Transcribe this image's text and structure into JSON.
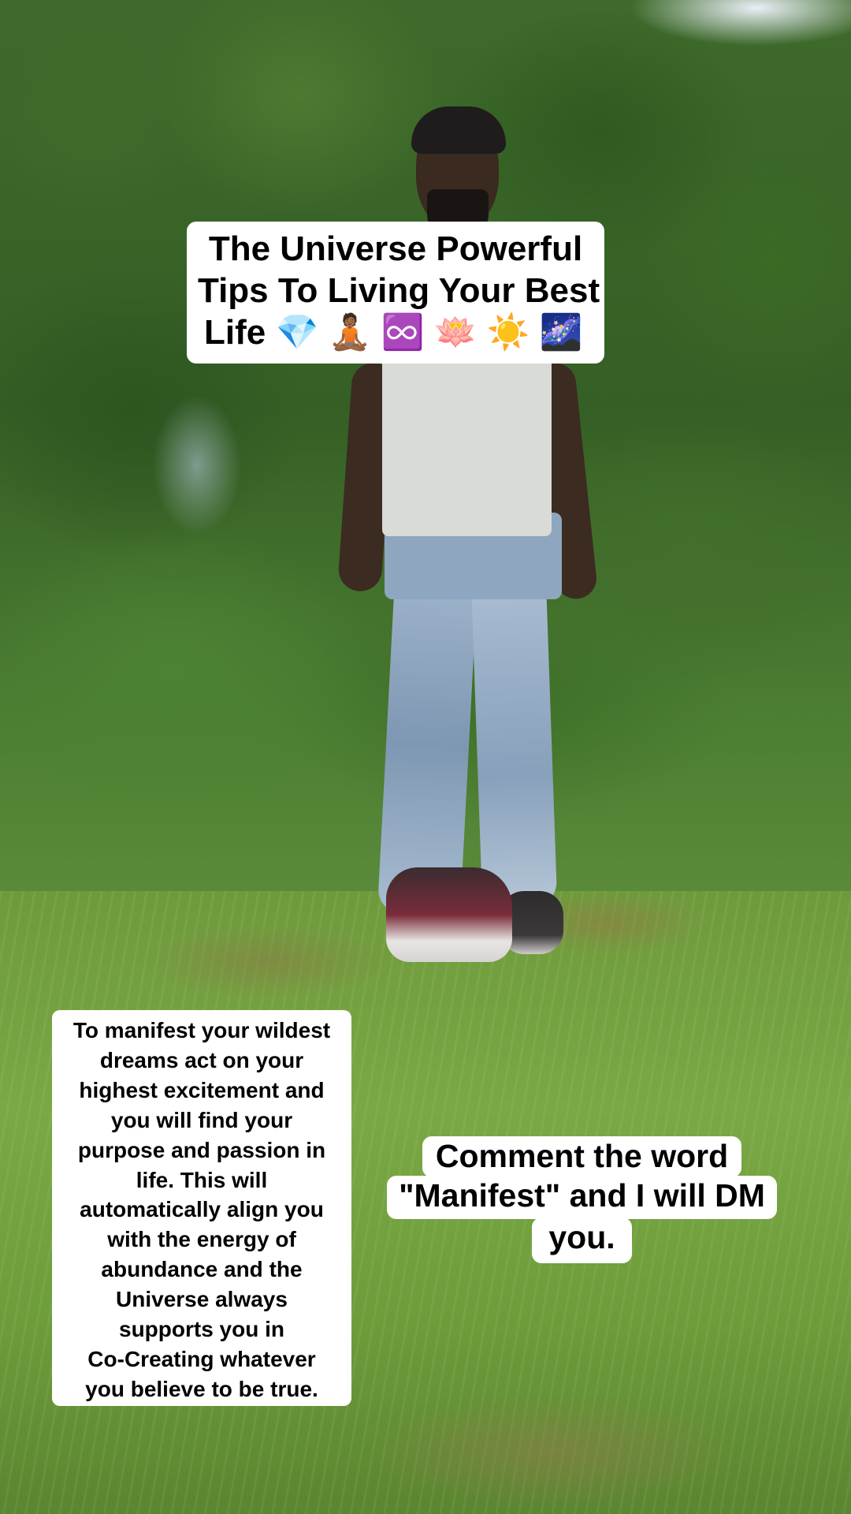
{
  "title_overlay": {
    "lines": [
      "The Universe Powerful",
      "Tips To Living Your Best",
      "Life 💎 🧘🏾 ♾️ 🪷 ☀️ 🌌"
    ]
  },
  "tips_overlay": {
    "lines": [
      "To manifest your wildest",
      "dreams act on your",
      "highest excitement and",
      "you will find your",
      "purpose and passion in",
      "life. This will",
      "automatically align you",
      "with the energy of",
      "abundance and the",
      "Universe always",
      "supports you in",
      "Co-Creating whatever",
      "you believe to be true."
    ]
  },
  "cta_overlay": {
    "lines": [
      "Comment the word",
      "\"Manifest\" and I will DM",
      "you."
    ]
  },
  "colors": {
    "caption_bg": "#ffffff",
    "caption_text": "#000000",
    "foliage": "#3e6a2b",
    "grass": "#79a844"
  }
}
